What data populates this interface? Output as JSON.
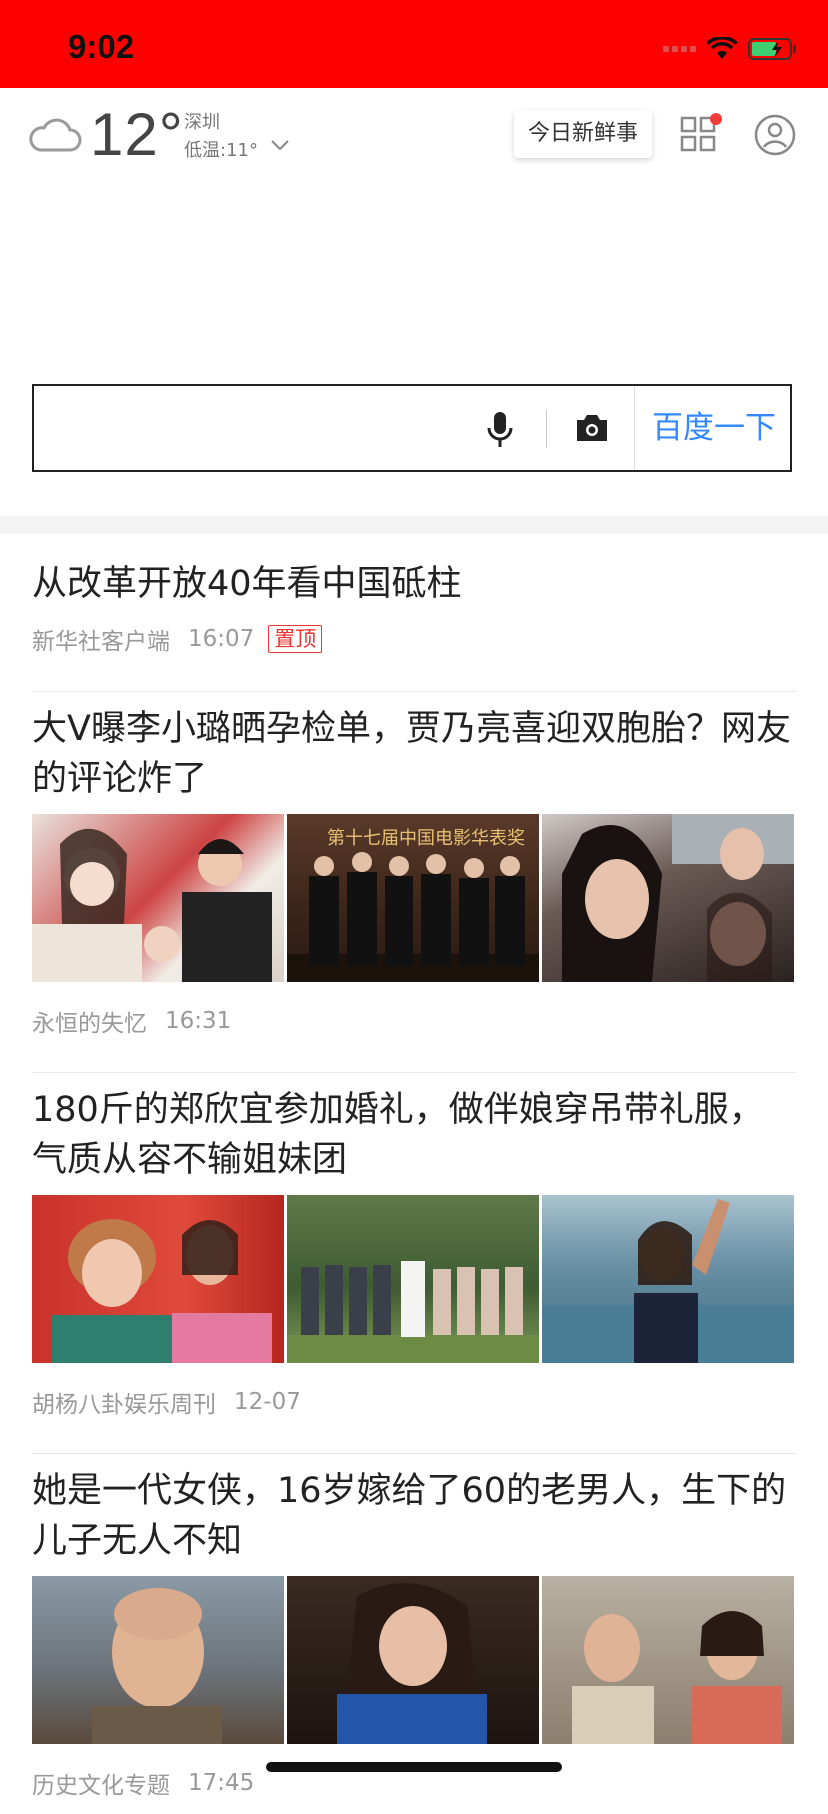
{
  "status_bar": {
    "time": "9:02",
    "background": "#ff0000"
  },
  "weather": {
    "temperature": "12°",
    "city": "深圳",
    "low": "低温:11°",
    "icon": "cloud-icon"
  },
  "header": {
    "fresh_button": "今日新鲜事"
  },
  "search": {
    "button": "百度一下",
    "accent": "#3388ff"
  },
  "feed": [
    {
      "title": "从改革开放40年看中国砥柱",
      "source": "新华社客户端",
      "time": "16:07",
      "tag": "置顶"
    },
    {
      "title": "大V曝李小璐晒孕检单，贾乃亮喜迎双胞胎？网友的评论炸了",
      "source": "永恒的失忆",
      "time": "16:31",
      "thumb_overlay": "第十七届中国电影华表奖"
    },
    {
      "title": "180斤的郑欣宜参加婚礼，做伴娘穿吊带礼服，气质从容不输姐妹团",
      "source": "胡杨八卦娱乐周刊",
      "time": "12-07"
    },
    {
      "title": "她是一代女侠，16岁嫁给了60的老男人，生下的儿子无人不知",
      "source": "历史文化专题",
      "time": "17:45"
    }
  ]
}
